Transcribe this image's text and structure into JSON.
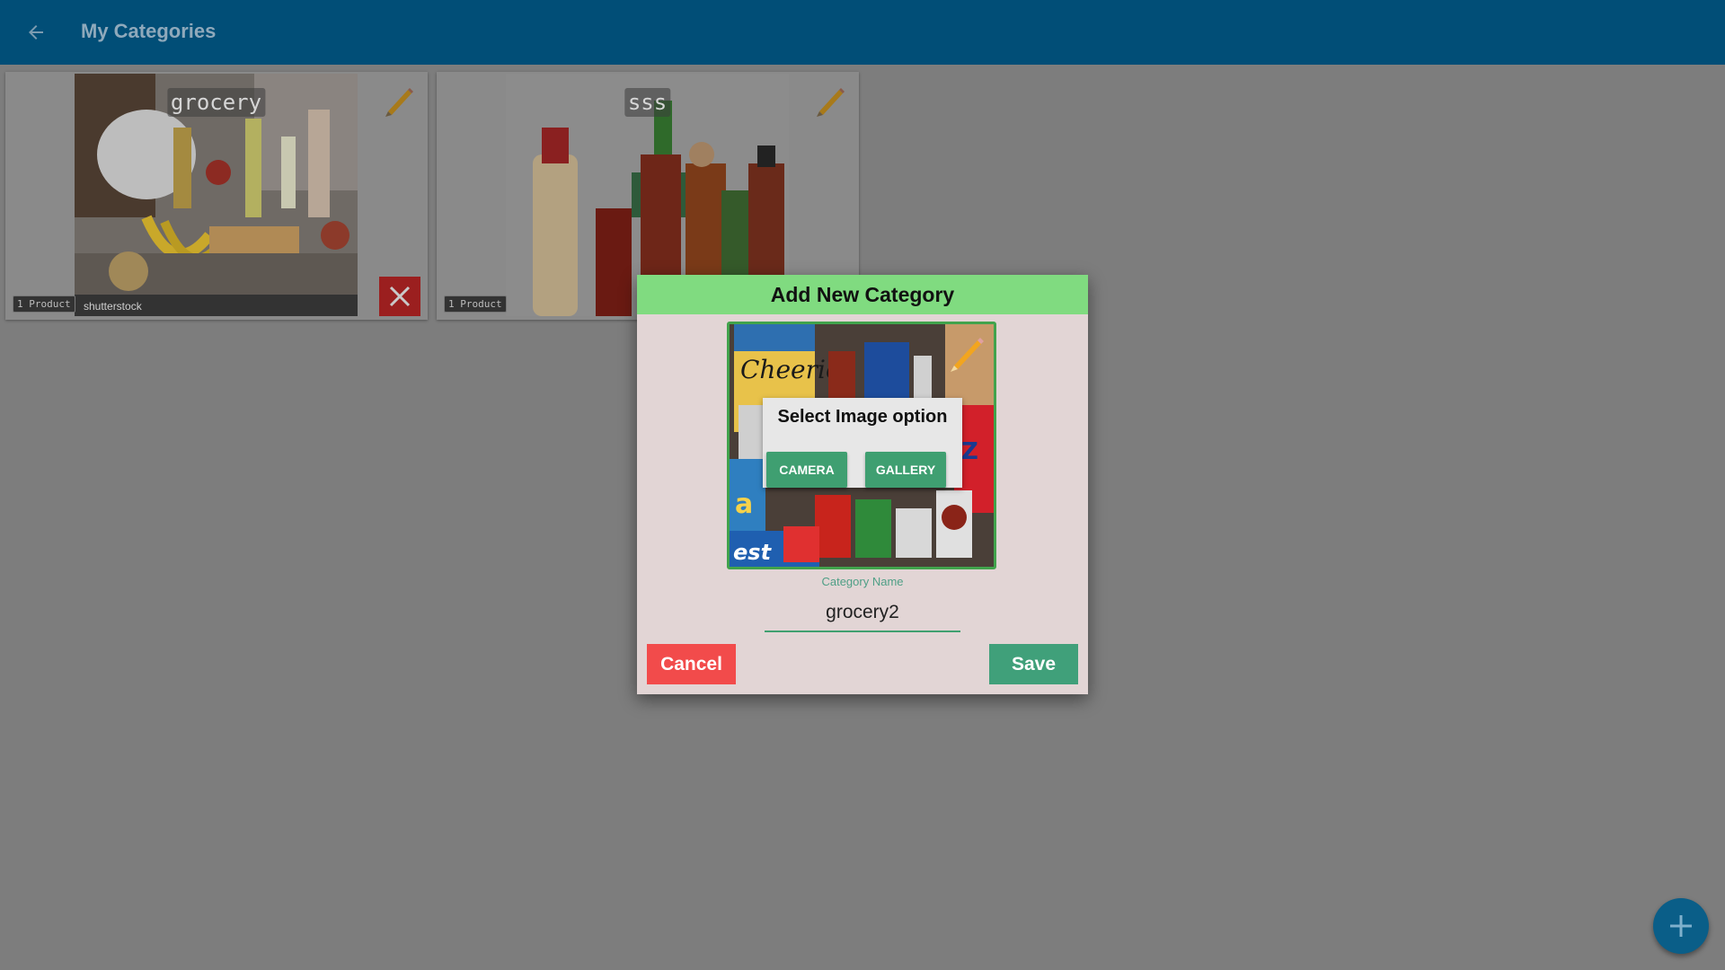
{
  "appbar": {
    "title": "My Categories",
    "back_icon": "arrow-left-icon"
  },
  "categories": [
    {
      "name": "grocery",
      "count": "1 Product",
      "watermark": "shutterstock"
    },
    {
      "name": "sss",
      "count": "1 Product"
    }
  ],
  "dialog": {
    "title": "Add New Category",
    "image_options": {
      "title": "Select Image option",
      "camera_label": "CAMERA",
      "gallery_label": "GALLERY"
    },
    "field": {
      "label": "Category Name",
      "value": "grocery2"
    },
    "cancel_label": "Cancel",
    "save_label": "Save"
  },
  "colors": {
    "appbar": "#014e77",
    "dialog_header": "#80db80",
    "accent_green": "#40a07a",
    "cancel_red": "#f24b4b"
  }
}
